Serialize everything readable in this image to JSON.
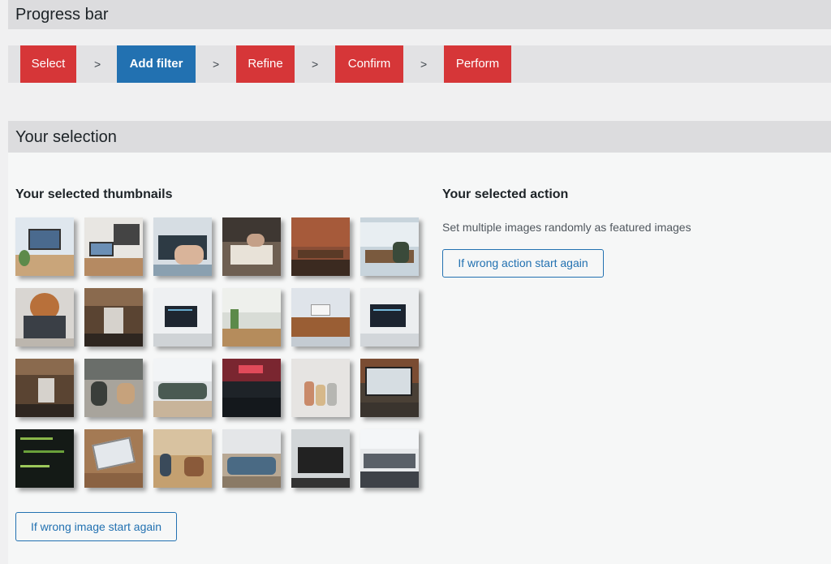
{
  "progress": {
    "title": "Progress bar",
    "steps": [
      {
        "label": "Select",
        "state": "done"
      },
      {
        "label": "Add filter",
        "state": "active"
      },
      {
        "label": "Refine",
        "state": "pending"
      },
      {
        "label": "Confirm",
        "state": "pending"
      },
      {
        "label": "Perform",
        "state": "pending"
      }
    ],
    "separator": ">"
  },
  "selection": {
    "title": "Your selection",
    "thumbnails_title": "Your selected thumbnails",
    "action_title": "Your selected action",
    "action_description": "Set multiple images randomly as featured images",
    "restart_action_label": "If wrong action start again",
    "restart_image_label": "If wrong image start again",
    "thumbnails_count": 24
  },
  "colors": {
    "step_done": "#d63638",
    "step_active": "#2271b1",
    "accent": "#2271b1"
  }
}
